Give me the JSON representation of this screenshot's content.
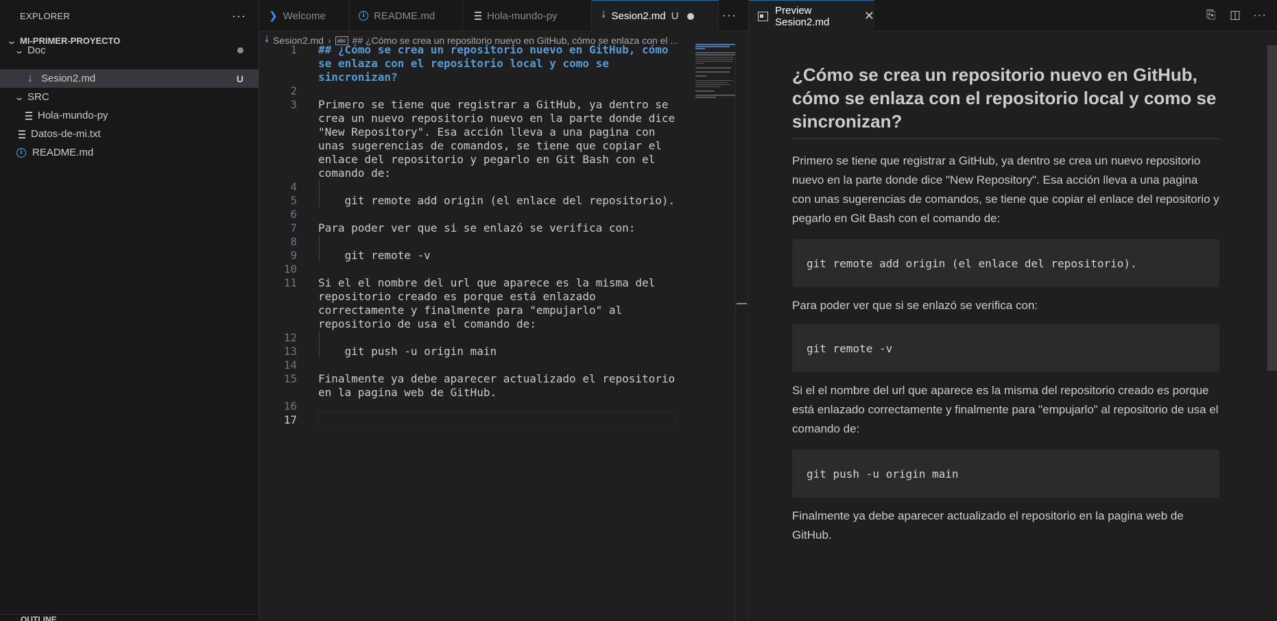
{
  "sidebar": {
    "title": "EXPLORER",
    "more": "···",
    "project": "MI-PRIMER-PROYECTO",
    "items": [
      {
        "label": "Doc"
      },
      {
        "label": "Sesion2.md",
        "badge": "U"
      },
      {
        "label": "SRC"
      },
      {
        "label": "Hola-mundo-py"
      },
      {
        "label": "Datos-de-mi.txt"
      },
      {
        "label": "README.md"
      }
    ],
    "outline": "OUTLINE"
  },
  "tabs": [
    {
      "label": "Welcome"
    },
    {
      "label": "README.md"
    },
    {
      "label": "Hola-mundo-py"
    },
    {
      "label": "Sesion2.md",
      "modified": "U"
    }
  ],
  "tabs_more": "···",
  "breadcrumb": {
    "file": "Sesion2.md",
    "abc": "abc",
    "section": "## ¿Cómo se crea un repositorio nuevo en GitHub, cómo se enlaza con el ..."
  },
  "editor": {
    "line_numbers": [
      "1",
      "2",
      "3",
      "4",
      "5",
      "6",
      "7",
      "8",
      "9",
      "10",
      "11",
      "12",
      "13",
      "14",
      "15",
      "16",
      "17"
    ],
    "lines": [
      "## ¿Cómo se crea un repositorio nuevo en GitHub, cómo",
      "se enlaza con el repositorio local y como se",
      "sincronizan?",
      "Primero se tiene que registrar a GitHub, ya dentro se",
      "crea un nuevo repositorio nuevo en la parte donde dice",
      "\"New Repository\". Esa acción lleva a una pagina con",
      "unas sugerencias de comandos, se tiene que copiar el",
      "enlace del repositorio y pegarlo en Git Bash con el",
      "comando de:",
      "    git remote add origin (el enlace del repositorio).",
      "Para poder ver que si se enlazó se verifica con:",
      "    git remote -v",
      "Si el el nombre del url que aparece es la misma del",
      "repositorio creado es porque está enlazado",
      "correctamente y finalmente para \"empujarlo\" al",
      "repositorio de usa el comando de:",
      "    git push -u origin main",
      "Finalmente ya debe aparecer actualizado el repositorio",
      "en la pagina web de GitHub."
    ]
  },
  "preview": {
    "tab_label": "Preview Sesion2.md",
    "close": "✕",
    "heading": "¿Cómo se crea un repositorio nuevo en GitHub, cómo se enlaza con el repositorio local y como se sincronizan?",
    "p1": "Primero se tiene que registrar a GitHub, ya dentro se crea un nuevo repositorio nuevo en la parte donde dice \"New Repository\". Esa acción lleva a una pagina con unas sugerencias de comandos, se tiene que copiar el enlace del repositorio y pegarlo en Git Bash con el comando de:",
    "code1": "git remote add origin (el enlace del repositorio).",
    "p2": "Para poder ver que si se enlazó se verifica con:",
    "code2": "git remote -v",
    "p3": "Si el el nombre del url que aparece es la misma del repositorio creado es porque está enlazado correctamente y finalmente para \"empujarlo\" al repositorio de usa el comando de:",
    "code3": "git push -u origin main",
    "p4": "Finalmente ya debe aparecer actualizado el repositorio en la pagina web de GitHub."
  },
  "colors": {
    "accent": "#0078d4",
    "heading": "#569cd6",
    "markdown_icon": "#519aba"
  }
}
